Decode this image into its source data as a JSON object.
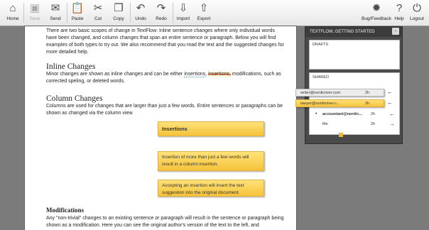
{
  "toolbar": {
    "items": [
      {
        "label": "Home",
        "icon": "home-icon"
      },
      {
        "label": "Save",
        "icon": "save-icon"
      },
      {
        "label": "Send",
        "icon": "mail-icon"
      },
      {
        "label": "Paste",
        "icon": "paste-icon"
      },
      {
        "label": "Cut",
        "icon": "scissors-icon"
      },
      {
        "label": "Copy",
        "icon": "copy-icon"
      },
      {
        "label": "Undo",
        "icon": "undo-icon"
      },
      {
        "label": "Redo",
        "icon": "redo-icon"
      },
      {
        "label": "Import",
        "icon": "import-icon"
      },
      {
        "label": "Export",
        "icon": "export-icon"
      }
    ],
    "right_items": [
      {
        "label": "Bug/Feedback",
        "icon": "bug-icon"
      },
      {
        "label": "Help",
        "icon": "help-icon"
      },
      {
        "label": "Logout",
        "icon": "power-icon"
      }
    ]
  },
  "document": {
    "intro": "There are two basic scopes of change in TextFlow: Inline sentence changes where only individual words have been changed, and column changes that span an entire sentence or paragraph. Below you will find examples of both types to try out. We also recommend that you read the text and the suggested changes for more detailed help.",
    "inline_heading": "Inline Changes",
    "inline_text_pre": "Minor changes are shown as inline changes and can be either ",
    "inline_word_ins": "insertions",
    "inline_sep": ", ",
    "inline_word_del": "insertions,",
    "inline_text_post": " modifications, such as corrected speling, or deleted words.",
    "column_heading": "Column Changes",
    "column_text": "Columns are used for changes that are larger than just a few words. Entire sentences or paragraphs can be shown as changed via the column view.",
    "sticky_title": "Insertions",
    "sticky_1": "Insertion of more than just a few words will result in a column insertion.",
    "sticky_2": "Accepting an insertion will insert the text suggestion into the original document.",
    "mod_heading": "Modifications",
    "mod_text": "Any \"non-trivial\" changes to an existing sentence or paragraph will result in the sentence or paragraph being shown as a modification. Here you can see the original author's version of the text to the left, and"
  },
  "panel": {
    "title": "TEXTFLOW, GETTING STARTED",
    "close_label": "-",
    "drafts_label": "DRAFTS",
    "shared_label": "SHARED",
    "rows": [
      {
        "name": "writer@nordicriver.com",
        "time": "2h"
      },
      {
        "name": "lawyer@nordicriver.c...",
        "time": "2h"
      },
      {
        "name": "accountant@nordic...",
        "time": "2h"
      },
      {
        "name": "Me",
        "time": "2h"
      }
    ]
  },
  "colors": {
    "accent": "#f5c33a",
    "panel": "#4a4a4a",
    "background": "#7b7b7b"
  }
}
